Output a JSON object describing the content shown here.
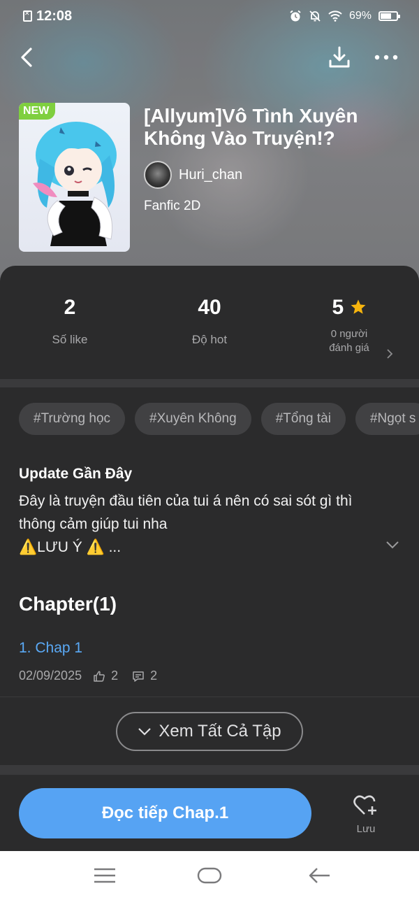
{
  "status_bar": {
    "time": "12:08",
    "battery": "69%"
  },
  "icons": {
    "back": "back-arrow-icon",
    "download": "download-icon",
    "more": "more-icon",
    "star": "star-icon",
    "like": "thumbs-up-icon",
    "comment": "comment-icon",
    "save": "heart-plus-icon"
  },
  "story": {
    "badge": "NEW",
    "title": "[Allyum]Vô Tình Xuyên Không Vào Truyện!?",
    "author": "Huri_chan",
    "genre": "Fanfic 2D"
  },
  "stats": {
    "likes": {
      "value": "2",
      "label": "Số like"
    },
    "hot": {
      "value": "40",
      "label": "Độ hot"
    },
    "rating": {
      "value": "5",
      "label_line1": "0 người",
      "label_line2": "đánh giá"
    }
  },
  "tags": [
    "#Trường học",
    "#Xuyên Không",
    "#Tổng tài",
    "#Ngọt s"
  ],
  "update": {
    "title": "Update Gần Đây",
    "line1": "Đây là truyện đầu tiên của tui á nên có sai sót gì thì",
    "line2": "thông cảm giúp tui nha",
    "line3": "⚠️LƯU Ý ⚠️ ..."
  },
  "chapters": {
    "heading": "Chapter(1)",
    "items": [
      {
        "title": "1. Chap 1",
        "date": "02/09/2025",
        "likes": "2",
        "comments": "2"
      }
    ],
    "see_all": "Xem Tất Cả Tập"
  },
  "actions": {
    "read": "Đọc tiếp Chap.1",
    "save": "Lưu"
  },
  "colors": {
    "accent": "#56a3f3",
    "badge": "#7fcf3f",
    "star": "#f6b40e",
    "panel": "#2b2b2c"
  }
}
